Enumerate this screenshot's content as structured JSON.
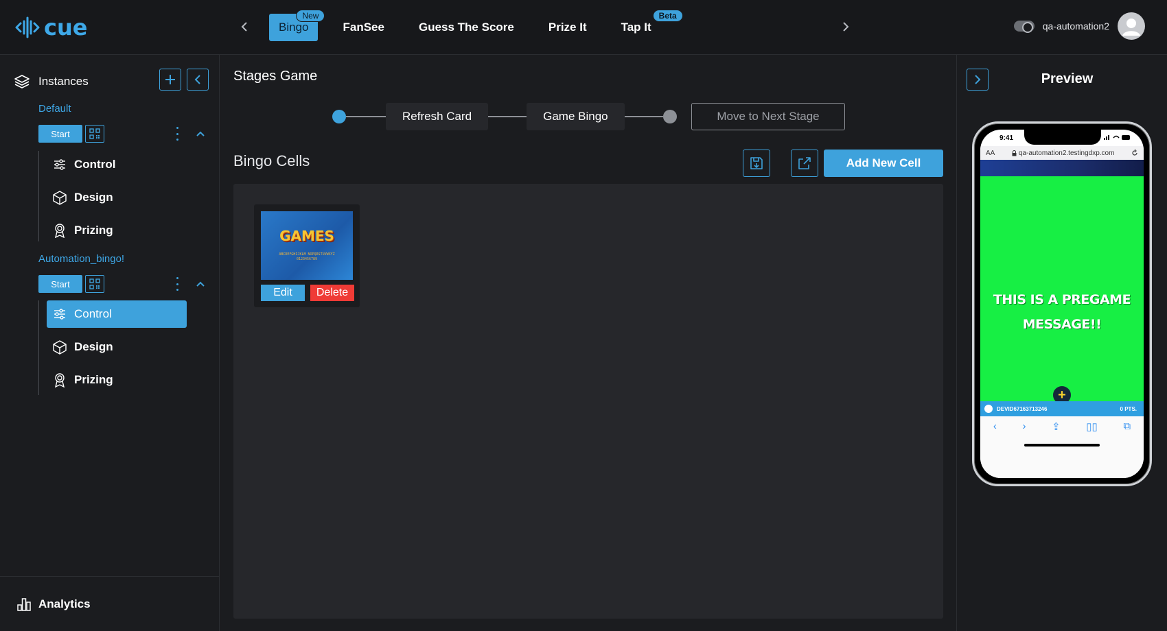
{
  "app": {
    "logo_text": "cue"
  },
  "topnav": {
    "tabs": [
      {
        "label": "Bingo",
        "badge": "New",
        "active": true
      },
      {
        "label": "FanSee",
        "badge": ""
      },
      {
        "label": "Guess The Score",
        "badge": ""
      },
      {
        "label": "Prize It",
        "badge": ""
      },
      {
        "label": "Tap It",
        "badge": "Beta"
      }
    ],
    "username": "qa-automation2"
  },
  "sidebar": {
    "title": "Instances",
    "instances": [
      {
        "name": "Default",
        "start_label": "Start",
        "items": [
          {
            "label": "Control"
          },
          {
            "label": "Design"
          },
          {
            "label": "Prizing"
          }
        ]
      },
      {
        "name": "Automation_bingo!",
        "start_label": "Start",
        "items": [
          {
            "label": "Control",
            "active": true
          },
          {
            "label": "Design"
          },
          {
            "label": "Prizing"
          }
        ]
      }
    ],
    "bottom": {
      "label": "Analytics"
    }
  },
  "main": {
    "title": "Stages Game",
    "stages": [
      "Refresh Card",
      "Game Bingo"
    ],
    "next_stage_label": "Move to Next Stage",
    "section_title": "Bingo Cells",
    "add_cell_label": "Add New Cell",
    "cells": [
      {
        "image_title": "GAMES",
        "image_sub": "ABCDEFGHIJKLM NOPQRSTUVWXYZ 0123456789",
        "edit_label": "Edit",
        "delete_label": "Delete"
      }
    ]
  },
  "preview": {
    "title": "Preview",
    "phone": {
      "time": "9:41",
      "url": "qa-automation2.testingdxp.com",
      "url_prefix": "AA",
      "message": "THIS IS A PREGAME MESSAGE!!",
      "user_id": "DEVID67163713246",
      "points": "0 PTS."
    }
  },
  "colors": {
    "accent": "#3ea2dc",
    "delete": "#ef3b36",
    "phone_bg": "#17ef44",
    "background": "#1b1c1f",
    "panel": "#26272b"
  }
}
